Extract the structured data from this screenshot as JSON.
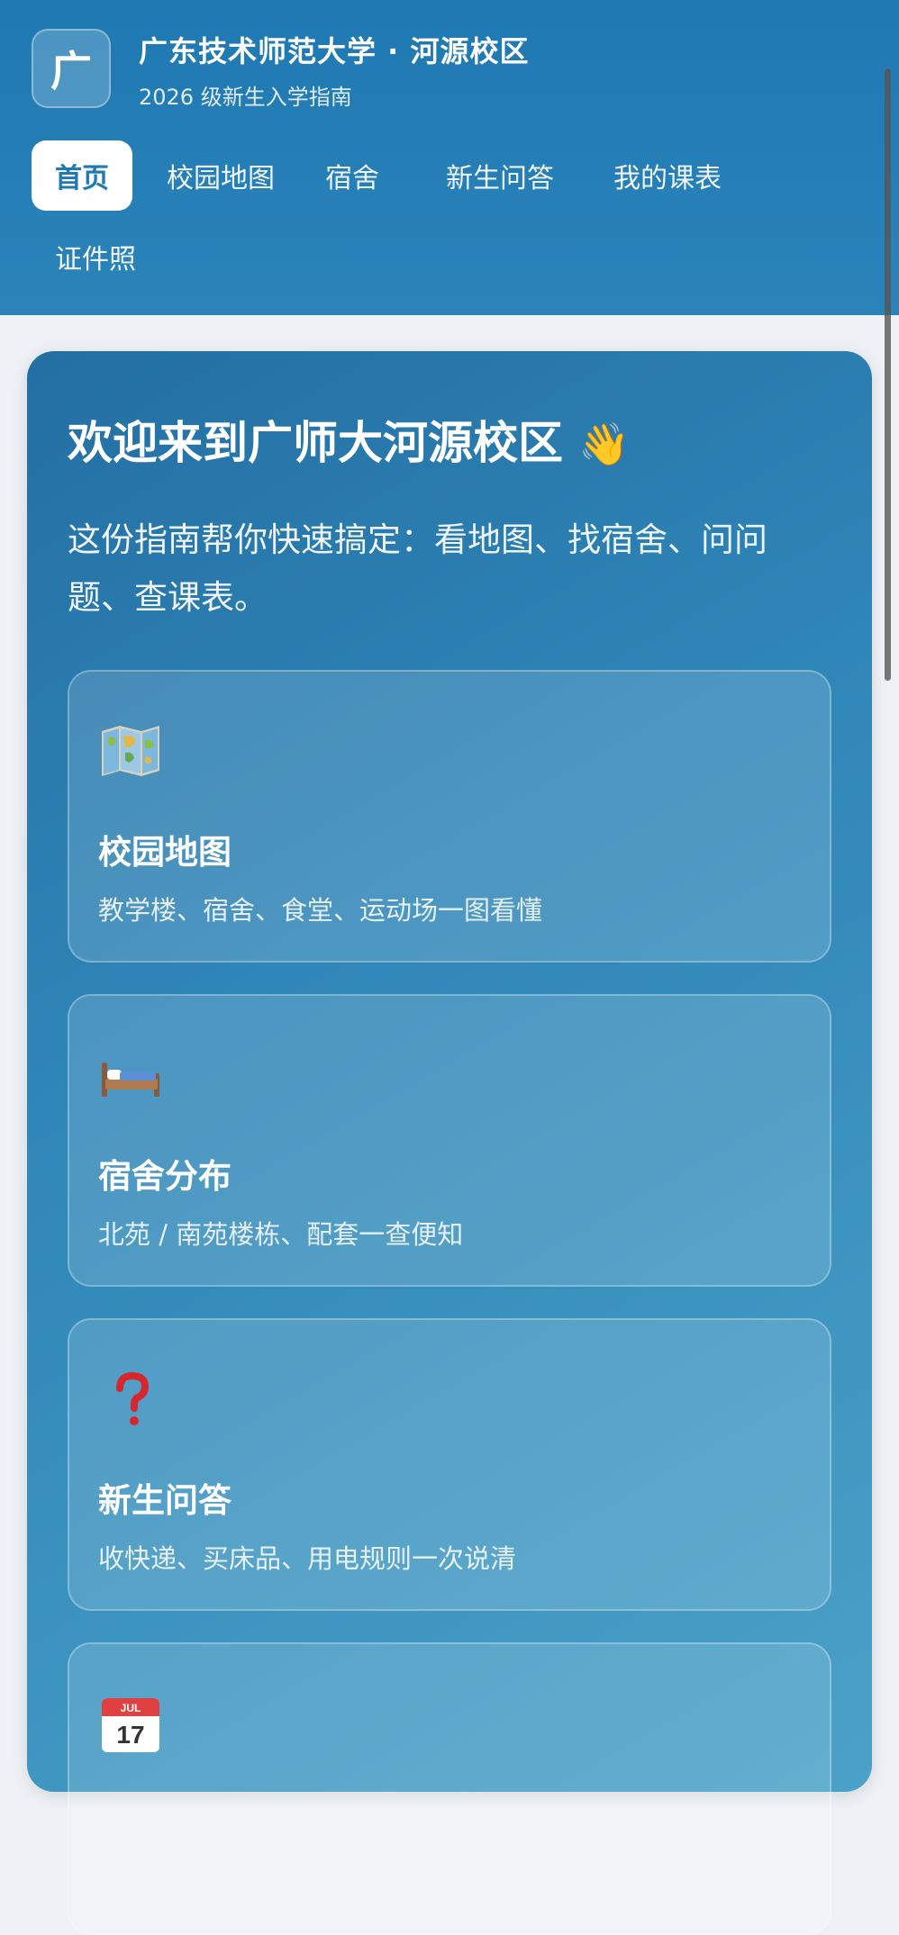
{
  "app": {
    "logo_char": "广",
    "title": "广东技术师范大学 · 河源校区",
    "subtitle": "2026 级新生入学指南"
  },
  "nav": {
    "tabs": [
      {
        "label": "首页",
        "active": true
      },
      {
        "label": "校园地图",
        "active": false
      },
      {
        "label": "宿舍",
        "active": false
      },
      {
        "label": "新生问答",
        "active": false
      },
      {
        "label": "我的课表",
        "active": false
      },
      {
        "label": "证件照",
        "active": false
      }
    ]
  },
  "hero": {
    "title": "欢迎来到广师大河源校区",
    "wave_emoji": "👋",
    "intro": "这份指南帮你快速搞定：看地图、找宿舍、问问题、查课表。"
  },
  "cards": [
    {
      "icon": "map-icon",
      "title": "校园地图",
      "desc": "教学楼、宿舍、食堂、运动场一图看懂"
    },
    {
      "icon": "bed-icon",
      "title": "宿舍分布",
      "desc": "北苑 / 南苑楼栋、配套一查便知"
    },
    {
      "icon": "question-icon",
      "title": "新生问答",
      "desc": "收快递、买床品、用电规则一次说清"
    },
    {
      "icon": "calendar-icon",
      "title": "",
      "desc": ""
    }
  ],
  "calendar_icon": {
    "month": "JUL",
    "day": "17"
  },
  "colors": {
    "header": "#1f79b2",
    "panel_start": "#246fa3",
    "panel_end": "#4aa2c8",
    "active_tab_text": "#1f79b2"
  }
}
